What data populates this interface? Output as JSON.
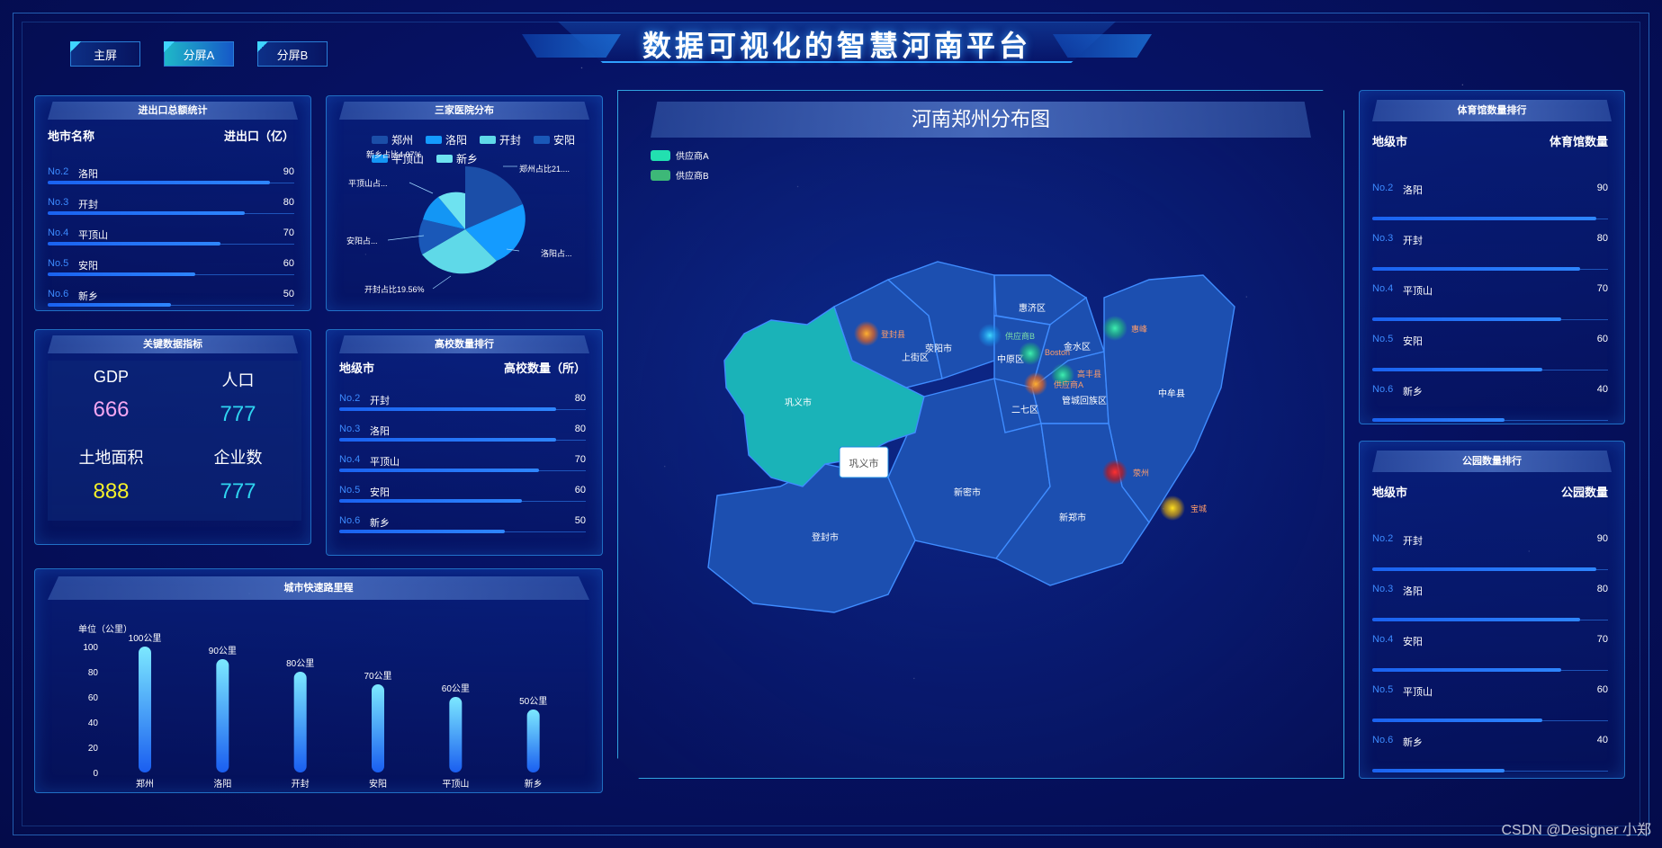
{
  "title": "数据可视化的智慧河南平台",
  "nav": [
    {
      "label": "主屏"
    },
    {
      "label": "分屏A"
    },
    {
      "label": "分屏B"
    }
  ],
  "import_export": {
    "title": "进出口总额统计",
    "head_left": "地市名称",
    "head_right": "进出口（亿）",
    "rows": [
      {
        "no": "No.2",
        "city": "洛阳",
        "value": "90",
        "pct": 0.9
      },
      {
        "no": "No.3",
        "city": "开封",
        "value": "80",
        "pct": 0.8
      },
      {
        "no": "No.4",
        "city": "平顶山",
        "value": "70",
        "pct": 0.7
      },
      {
        "no": "No.5",
        "city": "安阳",
        "value": "60",
        "pct": 0.6
      },
      {
        "no": "No.6",
        "city": "新乡",
        "value": "50",
        "pct": 0.5
      }
    ]
  },
  "hospital": {
    "title": "三家医院分布",
    "legend": [
      {
        "name": "郑州",
        "color": "#1b4ea8"
      },
      {
        "name": "洛阳",
        "color": "#149bff"
      },
      {
        "name": "开封",
        "color": "#5fd9e8"
      },
      {
        "name": "安阳",
        "color": "#1a58b8"
      },
      {
        "name": "平顶山",
        "color": "#1396f5"
      },
      {
        "name": "新乡",
        "color": "#6ee2f0"
      }
    ],
    "labels": {
      "xinxiang": "新乡占比4.07%",
      "zhengzhou": "郑州占比21....",
      "pingdingshan": "平顶山占...",
      "anyang": "安阳占...",
      "luoyang": "洛阳占...",
      "kaifeng": "开封占比19.56%"
    }
  },
  "kpi": {
    "title": "关键数据指标",
    "items": [
      {
        "label": "GDP",
        "value": "666",
        "color": "#f3a6f0"
      },
      {
        "label": "人口",
        "value": "777",
        "color": "#2fd4f0"
      },
      {
        "label": "土地面积",
        "value": "888",
        "color": "#f4f02a"
      },
      {
        "label": "企业数",
        "value": "777",
        "color": "#2fd4f0"
      }
    ]
  },
  "university": {
    "title": "高校数量排行",
    "head_left": "地级市",
    "head_right": "高校数量（所）",
    "rows": [
      {
        "no": "No.2",
        "city": "开封",
        "value": "80",
        "pct": 0.88
      },
      {
        "no": "No.3",
        "city": "洛阳",
        "value": "80",
        "pct": 0.88
      },
      {
        "no": "No.4",
        "city": "平顶山",
        "value": "70",
        "pct": 0.81
      },
      {
        "no": "No.5",
        "city": "安阳",
        "value": "60",
        "pct": 0.74
      },
      {
        "no": "No.6",
        "city": "新乡",
        "value": "50",
        "pct": 0.67
      }
    ]
  },
  "expressway": {
    "title": "城市快速路里程",
    "unit": "单位（公里）",
    "chart_data": {
      "type": "bar",
      "categories": [
        "郑州",
        "洛阳",
        "开封",
        "安阳",
        "平顶山",
        "新乡"
      ],
      "values": [
        100,
        90,
        80,
        70,
        60,
        50
      ],
      "data_labels": [
        "100公里",
        "90公里",
        "80公里",
        "70公里",
        "60公里",
        "50公里"
      ],
      "ylim": [
        0,
        100
      ],
      "yticks": [
        "0",
        "20",
        "40",
        "60",
        "80",
        "100"
      ]
    }
  },
  "map": {
    "title": "河南郑州分布图",
    "legend": [
      {
        "name": "供应商A",
        "color": "#22e0b0"
      },
      {
        "name": "供应商B",
        "color": "#3db878"
      }
    ],
    "districts": [
      "巩义市",
      "荥阳市",
      "上街区",
      "惠济区",
      "中原区",
      "金水区",
      "二七区",
      "管城回族区",
      "中牟县",
      "新密市",
      "新郑市",
      "登封市"
    ],
    "markers": [
      "登封县",
      "供应商B",
      "Boston",
      "高丰县",
      "供应商A",
      "惠峰",
      "荥州",
      "宝城"
    ],
    "tooltip": "巩义市"
  },
  "gym": {
    "title": "体育馆数量排行",
    "head_left": "地级市",
    "head_right": "体育馆数量",
    "rows": [
      {
        "no": "No.2",
        "city": "洛阳",
        "value": "90",
        "pct": 0.95
      },
      {
        "no": "No.3",
        "city": "开封",
        "value": "80",
        "pct": 0.88
      },
      {
        "no": "No.4",
        "city": "平顶山",
        "value": "70",
        "pct": 0.8
      },
      {
        "no": "No.5",
        "city": "安阳",
        "value": "60",
        "pct": 0.72
      },
      {
        "no": "No.6",
        "city": "新乡",
        "value": "40",
        "pct": 0.56
      }
    ]
  },
  "park": {
    "title": "公园数量排行",
    "head_left": "地级市",
    "head_right": "公园数量",
    "rows": [
      {
        "no": "No.2",
        "city": "开封",
        "value": "90",
        "pct": 0.95
      },
      {
        "no": "No.3",
        "city": "洛阳",
        "value": "80",
        "pct": 0.88
      },
      {
        "no": "No.4",
        "city": "安阳",
        "value": "70",
        "pct": 0.8
      },
      {
        "no": "No.5",
        "city": "平顶山",
        "value": "60",
        "pct": 0.72
      },
      {
        "no": "No.6",
        "city": "新乡",
        "value": "40",
        "pct": 0.56
      }
    ]
  },
  "watermark": "CSDN @Designer 小郑"
}
